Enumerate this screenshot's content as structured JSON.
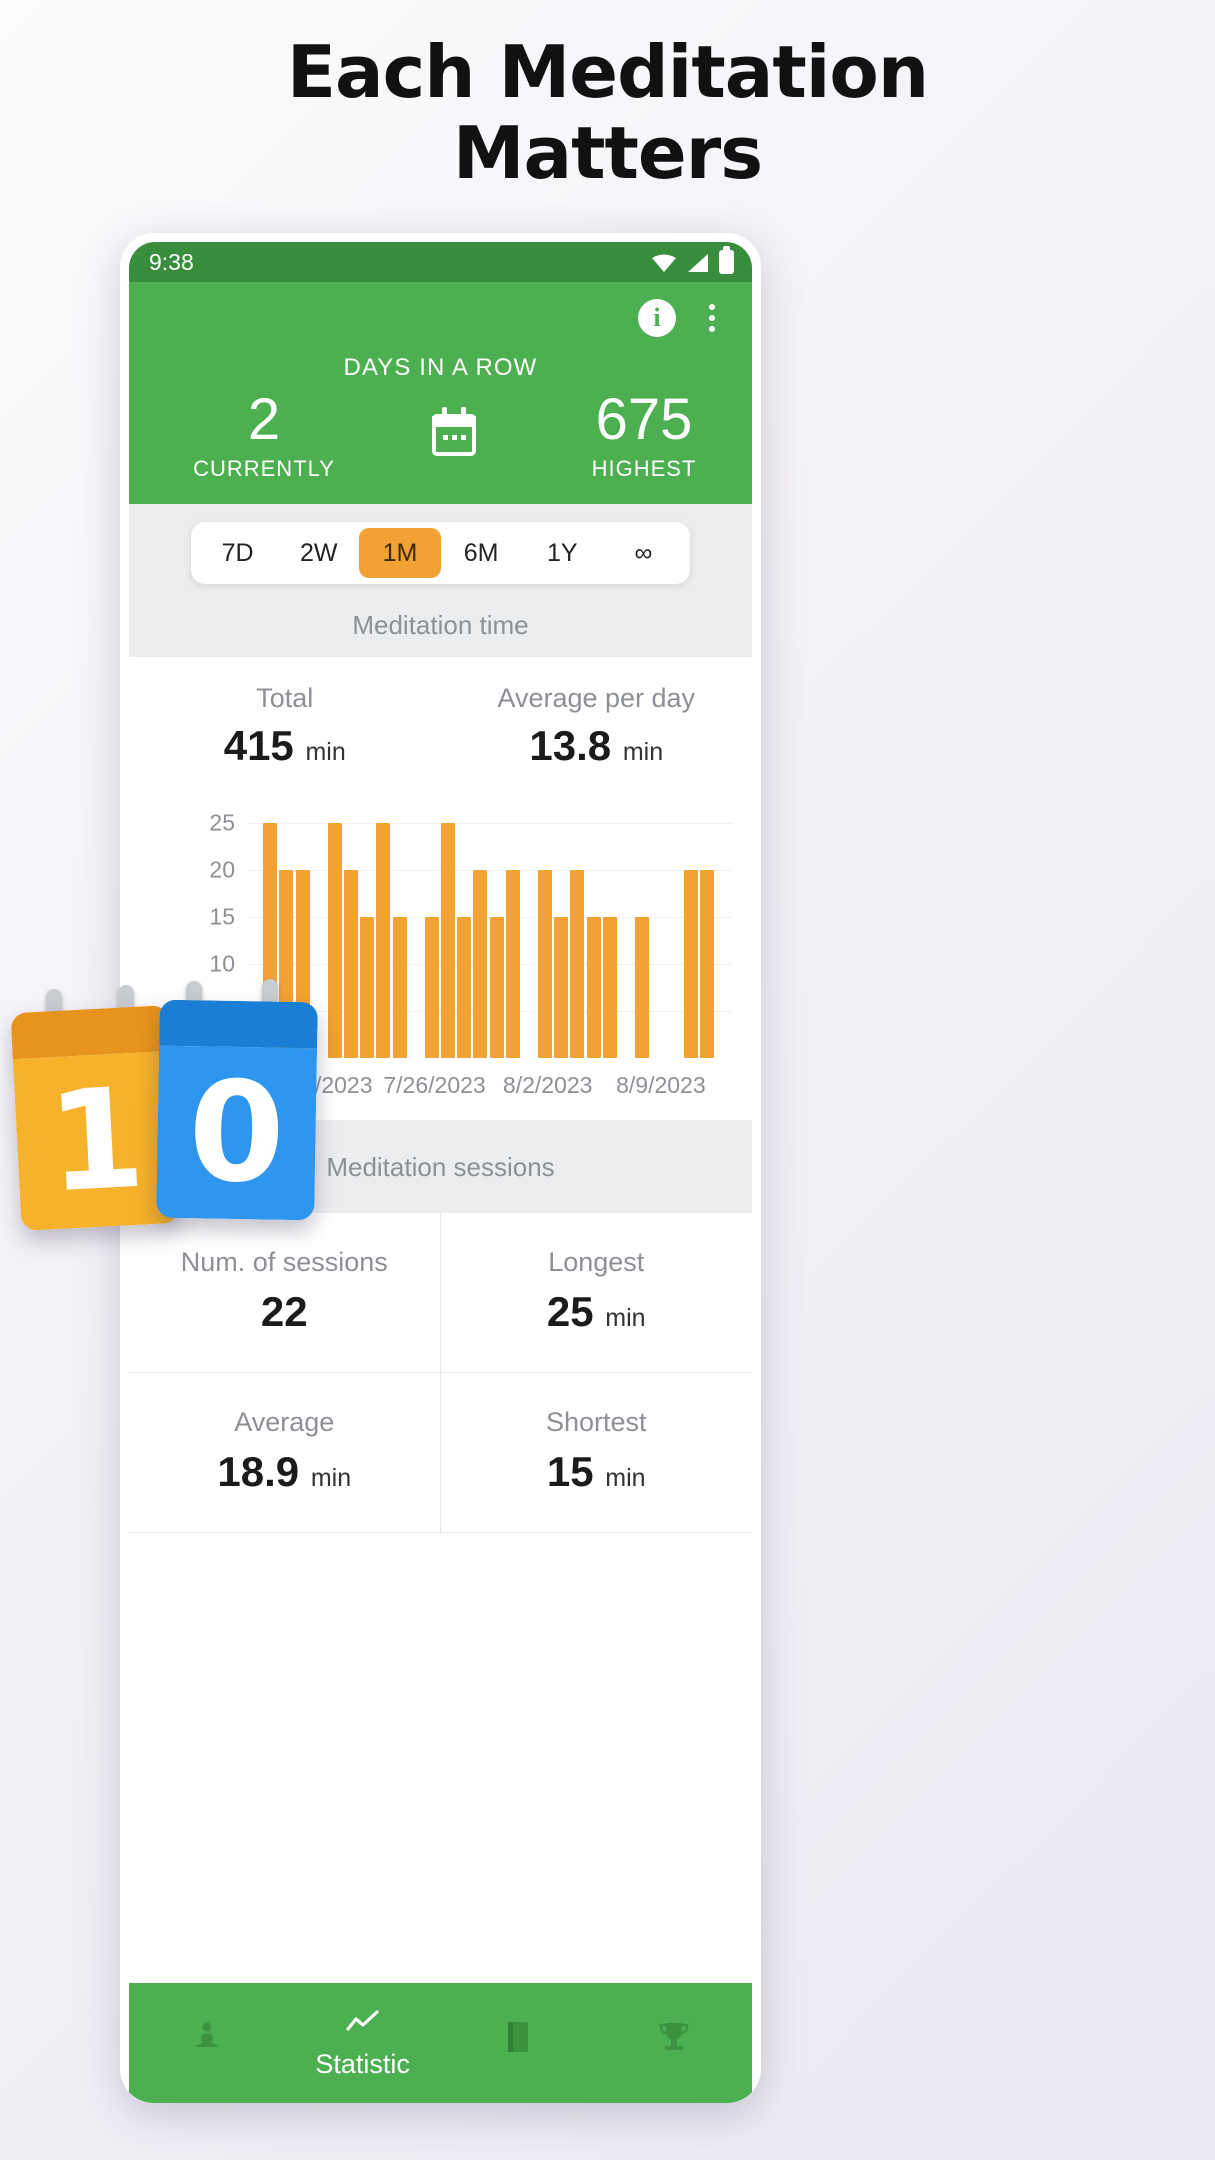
{
  "headline": {
    "line1": "Each Meditation",
    "line2": "Matters"
  },
  "statusbar": {
    "time": "9:38",
    "icons": [
      "wifi-icon",
      "signal-icon",
      "battery-icon"
    ]
  },
  "header": {
    "info_icon": "info-icon",
    "menu_icon": "overflow-menu-icon",
    "streak_title": "DAYS IN A ROW",
    "current_value": "2",
    "current_label": "CURRENTLY",
    "calendar_icon": "calendar-icon",
    "highest_value": "675",
    "highest_label": "HIGHEST",
    "green": "#4caf50",
    "statusbar_green": "#388e3c"
  },
  "range_tabs": {
    "items": [
      {
        "label": "7D",
        "active": false
      },
      {
        "label": "2W",
        "active": false
      },
      {
        "label": "1M",
        "active": true
      },
      {
        "label": "6M",
        "active": false
      },
      {
        "label": "1Y",
        "active": false
      },
      {
        "label": "∞",
        "active": false
      }
    ],
    "active_color": "#f2a133"
  },
  "meditation_time": {
    "section_label": "Meditation time",
    "total_label": "Total",
    "total_value": "415",
    "total_unit": "min",
    "avg_label": "Average per day",
    "avg_value": "13.8",
    "avg_unit": "min"
  },
  "chart_data": {
    "type": "bar",
    "title": "Meditation time",
    "xlabel": "",
    "ylabel": "",
    "ylim": [
      0,
      27
    ],
    "grid": true,
    "bar_color": "#f2a133",
    "yticks": [
      5,
      10,
      15,
      20,
      25
    ],
    "xticks": [
      {
        "label": "7/19/2023",
        "index": 3
      },
      {
        "label": "7/26/2023",
        "index": 10
      },
      {
        "label": "8/2/2023",
        "index": 17
      },
      {
        "label": "8/9/2023",
        "index": 24
      }
    ],
    "categories": [
      "7/16/2023",
      "7/17/2023",
      "7/18/2023",
      "7/19/2023",
      "7/20/2023",
      "7/21/2023",
      "7/22/2023",
      "7/23/2023",
      "7/24/2023",
      "7/25/2023",
      "7/26/2023",
      "7/27/2023",
      "7/28/2023",
      "7/29/2023",
      "7/30/2023",
      "7/31/2023",
      "8/1/2023",
      "8/2/2023",
      "8/3/2023",
      "8/4/2023",
      "8/5/2023",
      "8/6/2023",
      "8/7/2023",
      "8/8/2023",
      "8/9/2023",
      "8/10/2023",
      "8/11/2023"
    ],
    "values": [
      25,
      20,
      20,
      0,
      25,
      20,
      15,
      0,
      15,
      25,
      0,
      15,
      20,
      15,
      0,
      15,
      20,
      0,
      20,
      15,
      20,
      15,
      15,
      0,
      15,
      0,
      0
    ],
    "bars": [
      {
        "index": 1,
        "value": 25
      },
      {
        "index": 2,
        "value": 20
      },
      {
        "index": 3,
        "value": 20
      },
      {
        "index": 5,
        "value": 25
      },
      {
        "index": 6,
        "value": 20
      },
      {
        "index": 7,
        "value": 15
      },
      {
        "index": 8,
        "value": 25
      },
      {
        "index": 9,
        "value": 15
      },
      {
        "index": 11,
        "value": 15
      },
      {
        "index": 12,
        "value": 25
      },
      {
        "index": 13,
        "value": 15
      },
      {
        "index": 14,
        "value": 20
      },
      {
        "index": 15,
        "value": 15
      },
      {
        "index": 16,
        "value": 20
      },
      {
        "index": 18,
        "value": 20
      },
      {
        "index": 19,
        "value": 15
      },
      {
        "index": 20,
        "value": 20
      },
      {
        "index": 21,
        "value": 15
      },
      {
        "index": 22,
        "value": 15
      },
      {
        "index": 24,
        "value": 15
      },
      {
        "index": 27,
        "value": 20
      },
      {
        "index": 28,
        "value": 20
      }
    ]
  },
  "sessions": {
    "section_label": "Meditation sessions",
    "cells": [
      {
        "label": "Num. of sessions",
        "value": "22",
        "unit": ""
      },
      {
        "label": "Longest",
        "value": "25",
        "unit": "min"
      },
      {
        "label": "Average",
        "value": "18.9",
        "unit": "min"
      },
      {
        "label": "Shortest",
        "value": "15",
        "unit": "min"
      }
    ]
  },
  "bottom_nav": {
    "items": [
      {
        "icon": "meditation-icon",
        "glyph": "🧘",
        "label": ""
      },
      {
        "icon": "statistic-icon",
        "glyph": "↗",
        "label": "Statistic"
      },
      {
        "icon": "journal-icon",
        "glyph": "📕",
        "label": ""
      },
      {
        "icon": "trophy-icon",
        "glyph": "🏆",
        "label": ""
      }
    ]
  },
  "overlay": {
    "calendar_left": "1",
    "calendar_right": "0"
  }
}
